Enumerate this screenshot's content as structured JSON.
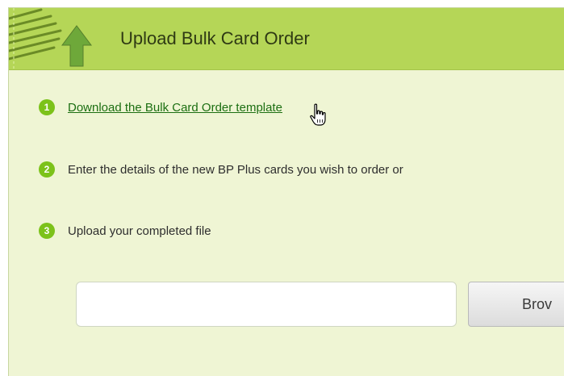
{
  "header": {
    "title": "Upload Bulk Card Order",
    "icon": "document-upload-icon"
  },
  "steps": [
    {
      "number": "1",
      "text": "Download the Bulk Card Order template",
      "is_link": true
    },
    {
      "number": "2",
      "text": "Enter the details of the new BP Plus cards you wish to order or",
      "is_link": false
    },
    {
      "number": "3",
      "text": "Upload your completed file",
      "is_link": false
    }
  ],
  "file_input": {
    "value": "",
    "placeholder": ""
  },
  "browse_button": {
    "label": "Brov"
  },
  "colors": {
    "header_bg": "#b5d657",
    "panel_bg": "#eff5d4",
    "step_badge": "#7cc21a",
    "link": "#1c6f12"
  }
}
